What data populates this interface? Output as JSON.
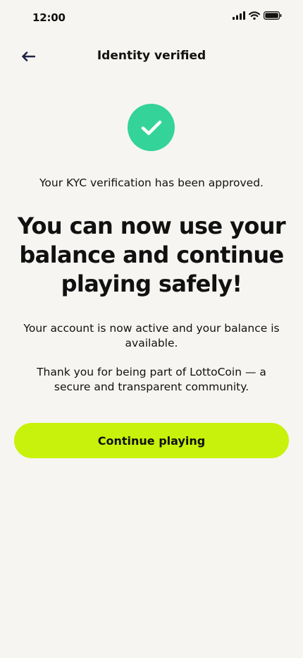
{
  "status_bar": {
    "time": "12:00",
    "icons": [
      "cellular-signal-icon",
      "wifi-icon",
      "battery-icon"
    ]
  },
  "header": {
    "back_icon": "arrow-left-icon",
    "title": "Identity verified"
  },
  "hero": {
    "icon": "check-circle-icon",
    "icon_color": "#34d399"
  },
  "content": {
    "kyc_message": "Your KYC verification has been approved.",
    "headline": "You can now use your balance and continue playing safely!",
    "account_message": "Your account is now active and your balance is available.",
    "community_message": "Thank you for being part of LottoCoin — a secure and transparent community."
  },
  "cta": {
    "label": "Continue playing",
    "color": "#c8f20b"
  },
  "colors": {
    "background": "#f6f5f1",
    "text": "#111111"
  }
}
